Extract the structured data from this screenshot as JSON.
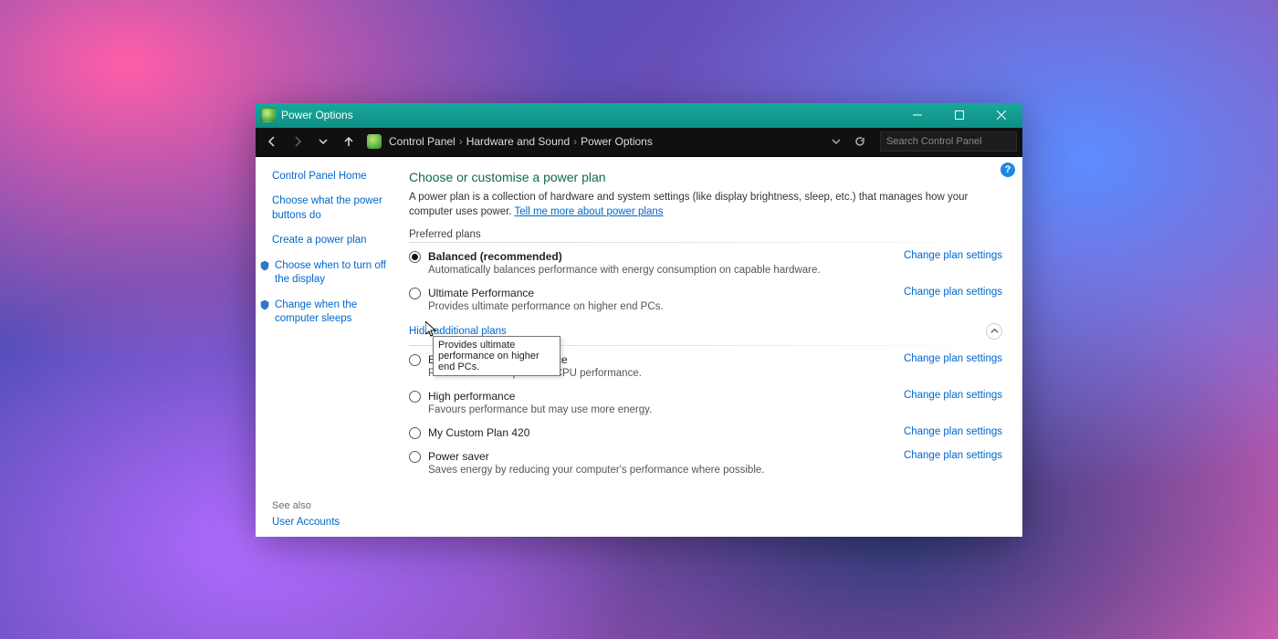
{
  "window": {
    "title": "Power Options"
  },
  "breadcrumbs": {
    "items": [
      "Control Panel",
      "Hardware and Sound",
      "Power Options"
    ]
  },
  "search": {
    "placeholder": "Search Control Panel"
  },
  "sidebar": {
    "home": "Control Panel Home",
    "links": [
      "Choose what the power buttons do",
      "Create a power plan",
      "Choose when to turn off the display",
      "Change when the computer sleeps"
    ],
    "see_also_label": "See also",
    "see_also_links": [
      "User Accounts"
    ]
  },
  "main": {
    "heading": "Choose or customise a power plan",
    "intro_text": "A power plan is a collection of hardware and system settings (like display brightness, sleep, etc.) that manages how your computer uses power. ",
    "intro_link": "Tell me more about power plans",
    "preferred_label": "Preferred plans",
    "hide_label": "Hide additional plans",
    "change_link": "Change plan settings",
    "preferred_plans": [
      {
        "name": "Balanced (recommended)",
        "desc": "Automatically balances performance with energy consumption on capable hardware.",
        "selected": true
      },
      {
        "name": "Ultimate Performance",
        "desc": "Provides ultimate performance on higher end PCs.",
        "selected": false
      }
    ],
    "additional_plans": [
      {
        "name": "Bitsum Highest Performance",
        "desc": "Provides Bitsum optimized CPU performance."
      },
      {
        "name": "High performance",
        "desc": "Favours performance but may use more energy."
      },
      {
        "name": "My Custom Plan 420",
        "desc": ""
      },
      {
        "name": "Power saver",
        "desc": "Saves energy by reducing your computer's performance where possible."
      }
    ]
  },
  "tooltip": {
    "text": "Provides ultimate performance on higher end PCs."
  },
  "help": {
    "glyph": "?"
  }
}
